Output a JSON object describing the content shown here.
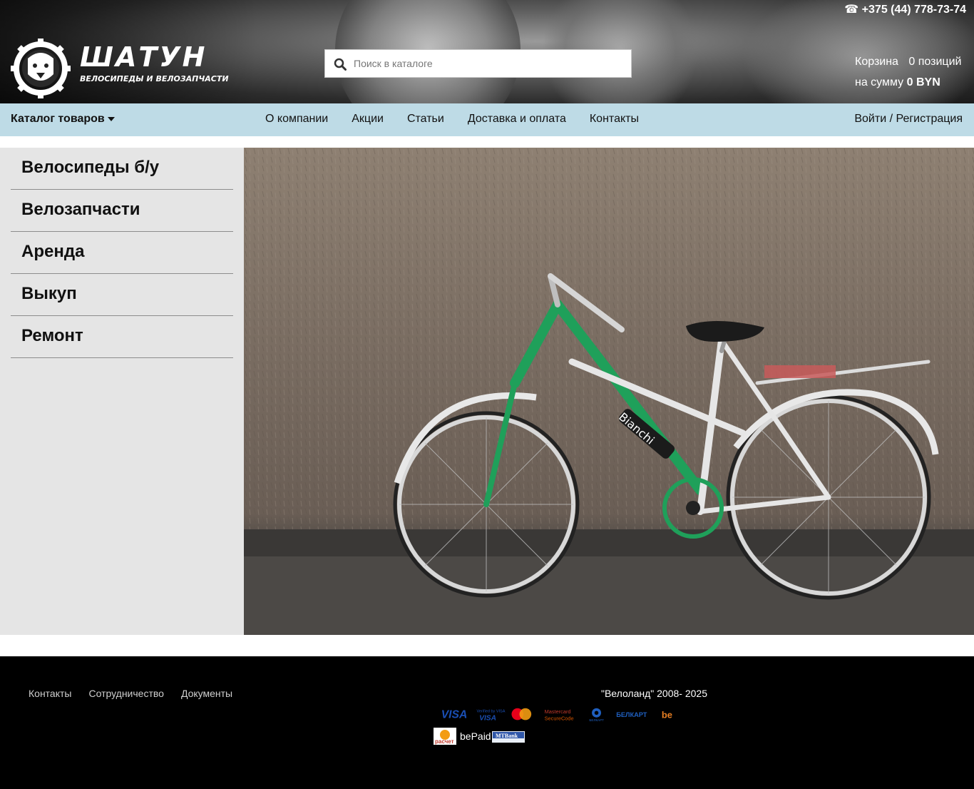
{
  "header": {
    "logo_title": "ШАТУН",
    "logo_subtitle": "ВЕЛОСИПЕДЫ И ВЕЛОЗАПЧАСТИ",
    "phone": "☎ +375 (44) 778-73-74",
    "search_placeholder": "Поиск в каталоге",
    "cart_label": "Корзина",
    "cart_count": "0 позиций",
    "cart_sum_label": "на сумму",
    "cart_sum_value": "0 BYN"
  },
  "nav": {
    "catalog": "Каталог товаров",
    "links": [
      "О компании",
      "Акции",
      "Статьи",
      "Доставка и оплата",
      "Контакты"
    ],
    "login": "Войти / Регистрация"
  },
  "sidebar": {
    "items": [
      "Велосипеды б/у",
      "Велозапчасти",
      "Аренда",
      "Выкуп",
      "Ремонт"
    ]
  },
  "hero": {
    "frame_color": "#1fa05a",
    "frame_label": "Bianchi"
  },
  "footer": {
    "links": [
      "Контакты",
      "Сотрудничество",
      "Документы"
    ],
    "copyright": "\"Велоланд\" 2008- 2025",
    "payment_logos": [
      "VISA",
      "Verified by VISA",
      "Mastercard",
      "Mastercard SecureCode",
      "БЕЛКАРТ",
      "БЕЛКАРТ Интернет-пароль",
      "be"
    ],
    "payment_logos_2": [
      "расчет",
      "bePaid",
      "MTBank"
    ]
  }
}
